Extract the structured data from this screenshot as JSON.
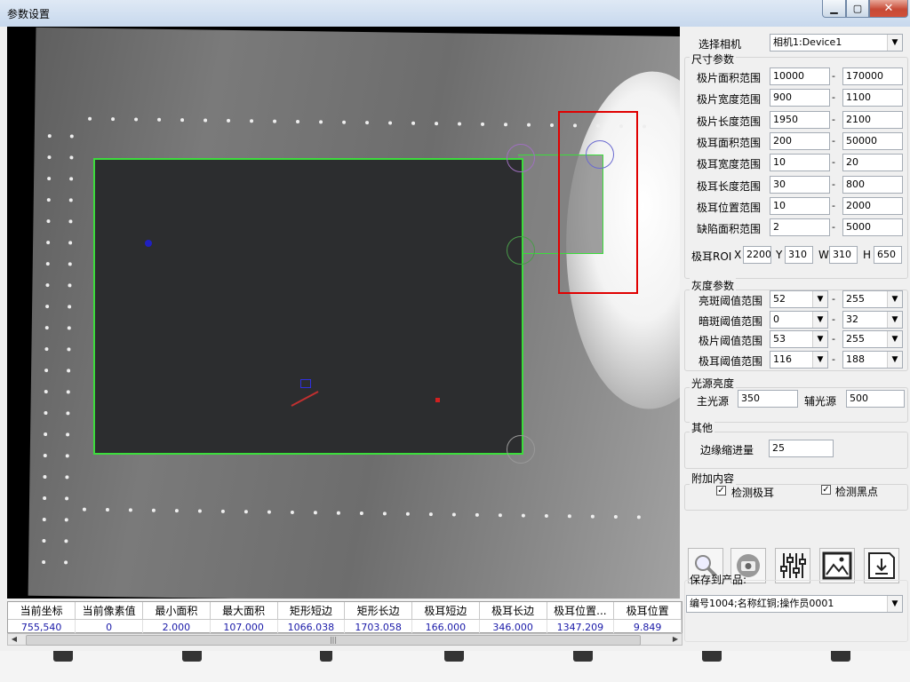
{
  "window": {
    "title": "参数设置",
    "minimize_glyph": "▁",
    "maximize_glyph": "▢",
    "close_glyph": "✕"
  },
  "camera": {
    "label": "选择相机",
    "value": "相机1:Device1"
  },
  "size_params": {
    "title": "尺寸参数",
    "rows": [
      {
        "label": "极片面积范围",
        "min": "10000",
        "max": "170000"
      },
      {
        "label": "极片宽度范围",
        "min": "900",
        "max": "1100"
      },
      {
        "label": "极片长度范围",
        "min": "1950",
        "max": "2100"
      },
      {
        "label": "极耳面积范围",
        "min": "200",
        "max": "50000"
      },
      {
        "label": "极耳宽度范围",
        "min": "10",
        "max": "20"
      },
      {
        "label": "极耳长度范围",
        "min": "30",
        "max": "800"
      },
      {
        "label": "极耳位置范围",
        "min": "10",
        "max": "2000"
      },
      {
        "label": "缺陷面积范围",
        "min": "2",
        "max": "5000"
      }
    ],
    "dash": "-",
    "roi": {
      "label": "极耳ROI",
      "x_label": "X",
      "x": "2200",
      "y_label": "Y",
      "y": "310",
      "w_label": "W",
      "w": "310",
      "h_label": "H",
      "h": "650"
    }
  },
  "gray_params": {
    "title": "灰度参数",
    "rows": [
      {
        "label": "亮斑阈值范围",
        "min": "52",
        "max": "255"
      },
      {
        "label": "暗斑阈值范围",
        "min": "0",
        "max": "32"
      },
      {
        "label": "极片阈值范围",
        "min": "53",
        "max": "255"
      },
      {
        "label": "极耳阈值范围",
        "min": "116",
        "max": "188"
      }
    ]
  },
  "light": {
    "title": "光源亮度",
    "main_label": "主光源",
    "main_value": "350",
    "aux_label": "辅光源",
    "aux_value": "500"
  },
  "other": {
    "title": "其他",
    "edge_label": "边缘缩进量",
    "edge_value": "25"
  },
  "extra": {
    "title": "附加内容",
    "check_tab_label": "检测极耳",
    "check_tab_checked": true,
    "check_spot_label": "检测黑点",
    "check_spot_checked": true
  },
  "tools": [
    {
      "icon": "magnifier-icon"
    },
    {
      "icon": "camera-icon"
    },
    {
      "icon": "sliders-icon"
    },
    {
      "icon": "image-icon"
    },
    {
      "icon": "save-disk-icon"
    }
  ],
  "save_product": {
    "label": "保存到产品:",
    "value": "编号1004;名称红铜;操作员0001"
  },
  "results": {
    "columns": [
      "当前坐标",
      "当前像素值",
      "最小面积",
      "最大面积",
      "矩形短边",
      "矩形长边",
      "极耳短边",
      "极耳长边",
      "极耳位置...",
      "极耳位置"
    ],
    "row": [
      "755,540",
      "0",
      "2.000",
      "107.000",
      "1066.038",
      "1703.058",
      "166.000",
      "346.000",
      "1347.209",
      "9.849"
    ]
  },
  "colors": {
    "contour_green": "#3cdc3c",
    "roi_red": "#e00000",
    "result_text_blue": "#1a1aa8"
  }
}
